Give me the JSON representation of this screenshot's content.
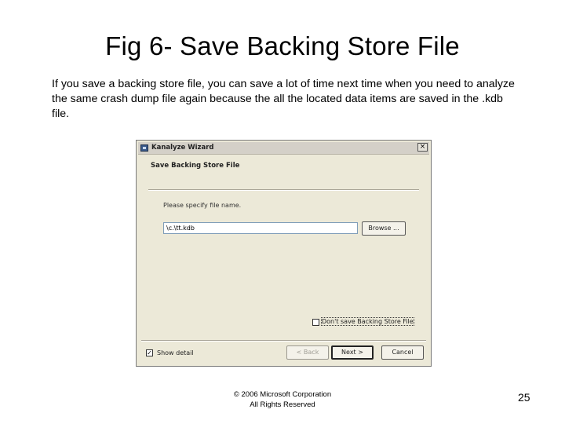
{
  "slide": {
    "title": "Fig 6- Save Backing Store File",
    "body": "If you save a backing store file, you can save a lot of time next time when you need to analyze the same crash dump file again because the all the located data items are saved in the .kdb file.",
    "footer_line1": "© 2006 Microsoft Corporation",
    "footer_line2": "All Rights Reserved",
    "page_number": "25"
  },
  "dialog": {
    "window_title": "Kanalyze Wizard",
    "close_glyph": "×",
    "header_title": "Save Backing Store File",
    "prompt": "Please specify file name.",
    "filename_value": "\\c.\\tt.kdb",
    "browse_label": "Browse ...",
    "dont_save_label": "Don't save Backing Store File",
    "dont_save_checked": false,
    "show_detail_label": "Show detail",
    "show_detail_checked": true,
    "check_glyph": "✓",
    "back_label": "< Back",
    "next_label": "Next >",
    "cancel_label": "Cancel"
  }
}
